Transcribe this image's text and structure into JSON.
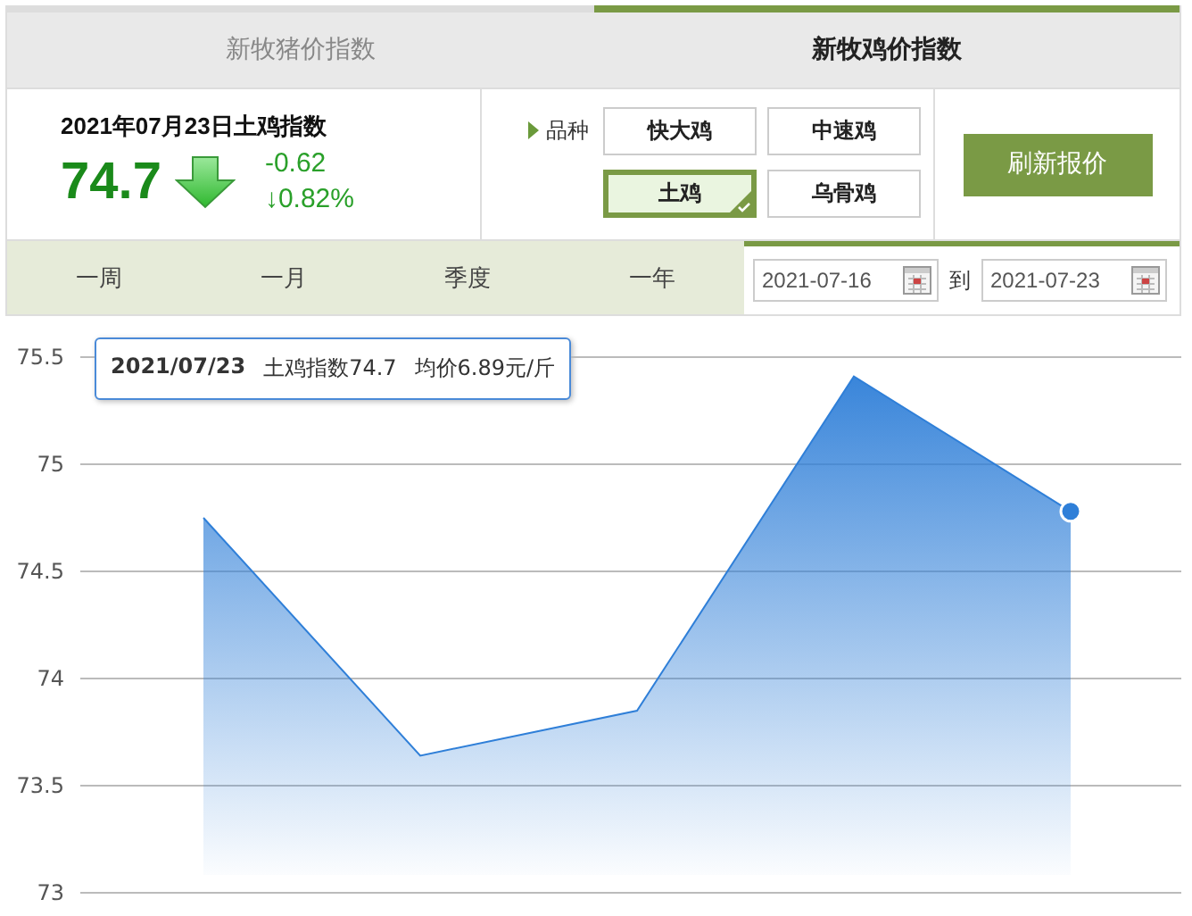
{
  "tabs": [
    {
      "label": "新牧猪价指数",
      "selected": false
    },
    {
      "label": "新牧鸡价指数",
      "selected": true
    }
  ],
  "index": {
    "title": "2021年07月23日土鸡指数",
    "value": "74.7",
    "change": "-0.62",
    "percent": "↓0.82%",
    "falling": true
  },
  "variety": {
    "label": "品种",
    "options": [
      {
        "label": "快大鸡",
        "selected": false
      },
      {
        "label": "中速鸡",
        "selected": false
      },
      {
        "label": "土鸡",
        "selected": true
      },
      {
        "label": "乌骨鸡",
        "selected": false
      }
    ]
  },
  "refresh_button": "刷新报价",
  "periods": [
    {
      "label": "一周",
      "selected": false
    },
    {
      "label": "一月",
      "selected": false
    },
    {
      "label": "季度",
      "selected": false
    },
    {
      "label": "一年",
      "selected": false
    }
  ],
  "date_range": {
    "from": "2021-07-16",
    "separator": "到",
    "to": "2021-07-23"
  },
  "chart": {
    "tooltip": {
      "date": "2021/07/23",
      "index": "土鸡指数74.7",
      "price": "均价6.89元/斤"
    },
    "chart_data": {
      "type": "area",
      "grid": true,
      "values": [
        74.75,
        73.64,
        73.85,
        75.41,
        74.78
      ],
      "ylim": [
        73,
        75.5
      ],
      "yticks": [
        {
          "value": 73,
          "label": "73"
        },
        {
          "value": 73.5,
          "label": "73.5"
        },
        {
          "value": 74,
          "label": "74"
        },
        {
          "value": 74.5,
          "label": "74.5"
        },
        {
          "value": 75,
          "label": "75"
        },
        {
          "value": 75.5,
          "label": "75.5"
        }
      ]
    }
  }
}
